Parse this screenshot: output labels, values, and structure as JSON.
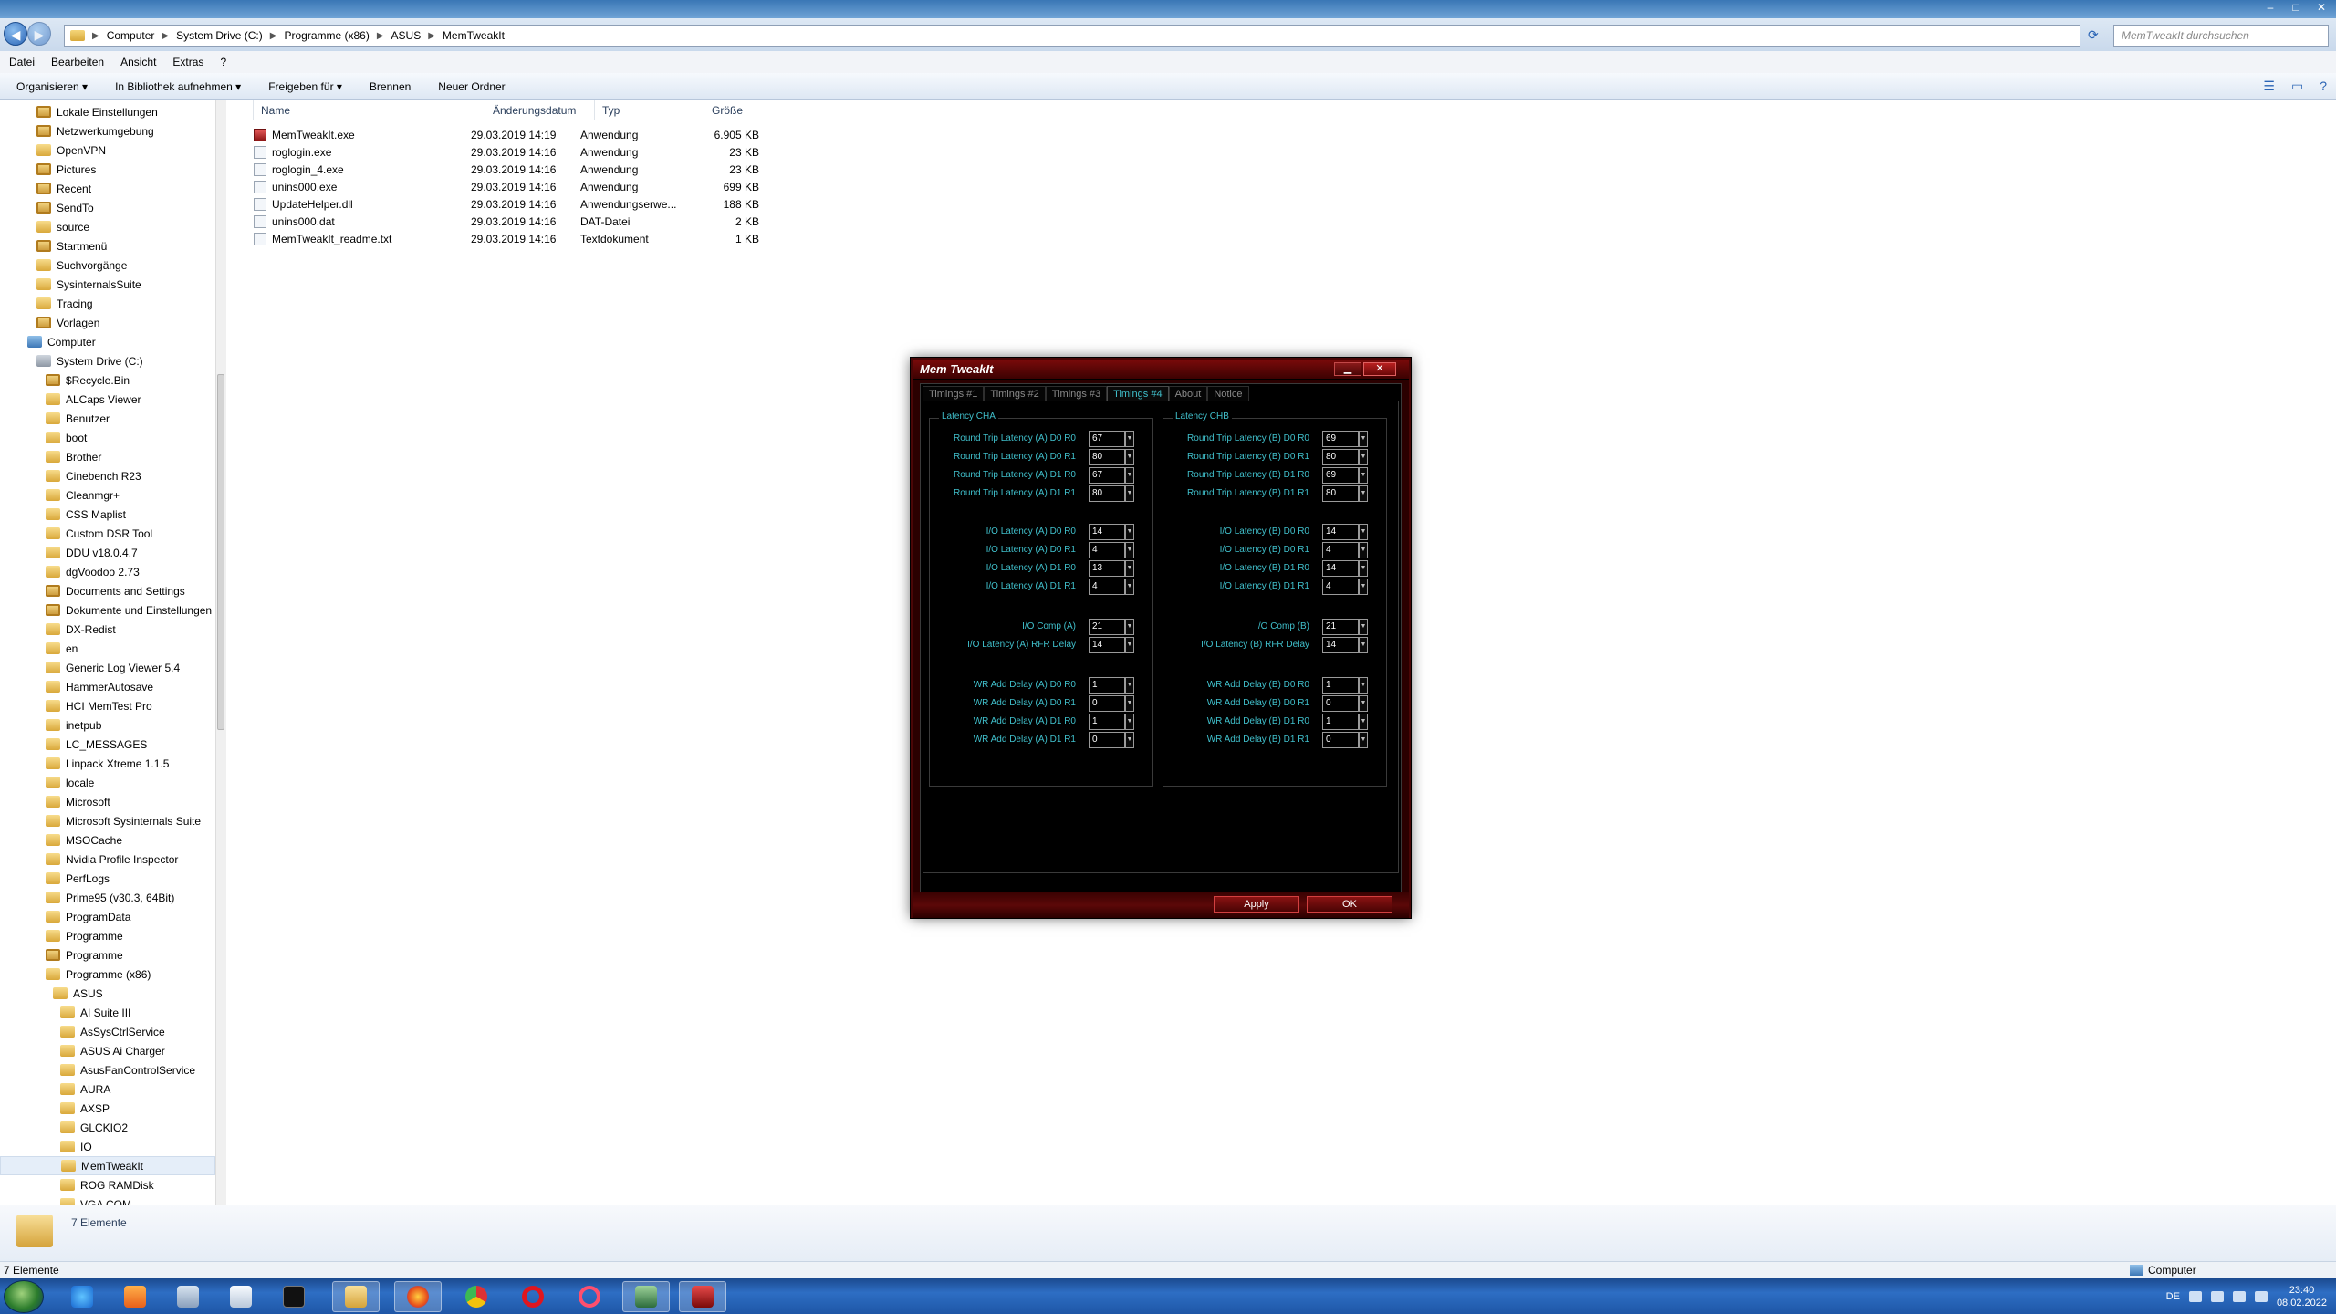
{
  "window": {
    "controls": [
      "–",
      "□",
      "✕"
    ]
  },
  "address": {
    "crumbs": [
      "Computer",
      "System Drive (C:)",
      "Programme (x86)",
      "ASUS",
      "MemTweakIt"
    ],
    "search_placeholder": "MemTweakIt durchsuchen"
  },
  "menubar": [
    "Datei",
    "Bearbeiten",
    "Ansicht",
    "Extras",
    "?"
  ],
  "toolbar": [
    "Organisieren ▾",
    "In Bibliothek aufnehmen ▾",
    "Freigeben für ▾",
    "Brennen",
    "Neuer Ordner"
  ],
  "nav": [
    {
      "label": "Lokale Einstellungen",
      "indent": 1,
      "icon": "special"
    },
    {
      "label": "Netzwerkumgebung",
      "indent": 1,
      "icon": "special"
    },
    {
      "label": "OpenVPN",
      "indent": 1,
      "icon": "folder"
    },
    {
      "label": "Pictures",
      "indent": 1,
      "icon": "special"
    },
    {
      "label": "Recent",
      "indent": 1,
      "icon": "special"
    },
    {
      "label": "SendTo",
      "indent": 1,
      "icon": "special"
    },
    {
      "label": "source",
      "indent": 1,
      "icon": "folder"
    },
    {
      "label": "Startmenü",
      "indent": 1,
      "icon": "special"
    },
    {
      "label": "Suchvorgänge",
      "indent": 1,
      "icon": "folder"
    },
    {
      "label": "SysinternalsSuite",
      "indent": 1,
      "icon": "folder"
    },
    {
      "label": "Tracing",
      "indent": 1,
      "icon": "folder"
    },
    {
      "label": "Vorlagen",
      "indent": 1,
      "icon": "special"
    },
    {
      "label": "Computer",
      "indent": 0,
      "icon": "pc"
    },
    {
      "label": "System Drive (C:)",
      "indent": 1,
      "icon": "drive"
    },
    {
      "label": "$Recycle.Bin",
      "indent": 2,
      "icon": "special"
    },
    {
      "label": "ALCaps Viewer",
      "indent": 2,
      "icon": "folder"
    },
    {
      "label": "Benutzer",
      "indent": 2,
      "icon": "folder"
    },
    {
      "label": "boot",
      "indent": 2,
      "icon": "folder"
    },
    {
      "label": "Brother",
      "indent": 2,
      "icon": "folder"
    },
    {
      "label": "Cinebench R23",
      "indent": 2,
      "icon": "folder"
    },
    {
      "label": "Cleanmgr+",
      "indent": 2,
      "icon": "folder"
    },
    {
      "label": "CSS Maplist",
      "indent": 2,
      "icon": "folder"
    },
    {
      "label": "Custom DSR Tool",
      "indent": 2,
      "icon": "folder"
    },
    {
      "label": "DDU v18.0.4.7",
      "indent": 2,
      "icon": "folder"
    },
    {
      "label": "dgVoodoo 2.73",
      "indent": 2,
      "icon": "folder"
    },
    {
      "label": "Documents and Settings",
      "indent": 2,
      "icon": "special"
    },
    {
      "label": "Dokumente und Einstellungen",
      "indent": 2,
      "icon": "special"
    },
    {
      "label": "DX-Redist",
      "indent": 2,
      "icon": "folder"
    },
    {
      "label": "en",
      "indent": 2,
      "icon": "folder"
    },
    {
      "label": "Generic Log Viewer 5.4",
      "indent": 2,
      "icon": "folder"
    },
    {
      "label": "HammerAutosave",
      "indent": 2,
      "icon": "folder"
    },
    {
      "label": "HCI MemTest Pro",
      "indent": 2,
      "icon": "folder"
    },
    {
      "label": "inetpub",
      "indent": 2,
      "icon": "folder"
    },
    {
      "label": "LC_MESSAGES",
      "indent": 2,
      "icon": "folder"
    },
    {
      "label": "Linpack Xtreme 1.1.5",
      "indent": 2,
      "icon": "folder"
    },
    {
      "label": "locale",
      "indent": 2,
      "icon": "folder"
    },
    {
      "label": "Microsoft",
      "indent": 2,
      "icon": "folder"
    },
    {
      "label": "Microsoft Sysinternals Suite",
      "indent": 2,
      "icon": "folder"
    },
    {
      "label": "MSOCache",
      "indent": 2,
      "icon": "folder"
    },
    {
      "label": "Nvidia Profile Inspector",
      "indent": 2,
      "icon": "folder"
    },
    {
      "label": "PerfLogs",
      "indent": 2,
      "icon": "folder"
    },
    {
      "label": "Prime95 (v30.3, 64Bit)",
      "indent": 2,
      "icon": "folder"
    },
    {
      "label": "ProgramData",
      "indent": 2,
      "icon": "folder"
    },
    {
      "label": "Programme",
      "indent": 2,
      "icon": "folder"
    },
    {
      "label": "Programme",
      "indent": 2,
      "icon": "special"
    },
    {
      "label": "Programme (x86)",
      "indent": 2,
      "icon": "folder"
    },
    {
      "label": "ASUS",
      "indent": 3,
      "icon": "folder"
    },
    {
      "label": "AI Suite III",
      "indent": 4,
      "icon": "folder"
    },
    {
      "label": "AsSysCtrlService",
      "indent": 4,
      "icon": "folder"
    },
    {
      "label": "ASUS Ai Charger",
      "indent": 4,
      "icon": "folder"
    },
    {
      "label": "AsusFanControlService",
      "indent": 4,
      "icon": "folder"
    },
    {
      "label": "AURA",
      "indent": 4,
      "icon": "folder"
    },
    {
      "label": "AXSP",
      "indent": 4,
      "icon": "folder"
    },
    {
      "label": "GLCKIO2",
      "indent": 4,
      "icon": "folder"
    },
    {
      "label": "IO",
      "indent": 4,
      "icon": "folder"
    },
    {
      "label": "MemTweakIt",
      "indent": 4,
      "icon": "folder",
      "selected": true
    },
    {
      "label": "ROG RAMDisk",
      "indent": 4,
      "icon": "folder"
    },
    {
      "label": "VGA COM",
      "indent": 4,
      "icon": "folder"
    }
  ],
  "columns": [
    "Name",
    "Änderungsdatum",
    "Typ",
    "Größe"
  ],
  "files": [
    {
      "name": "MemTweakIt.exe",
      "date": "29.03.2019 14:19",
      "type": "Anwendung",
      "size": "6.905 KB",
      "icon": "exe"
    },
    {
      "name": "roglogin.exe",
      "date": "29.03.2019 14:16",
      "type": "Anwendung",
      "size": "23 KB",
      "icon": "file"
    },
    {
      "name": "roglogin_4.exe",
      "date": "29.03.2019 14:16",
      "type": "Anwendung",
      "size": "23 KB",
      "icon": "file"
    },
    {
      "name": "unins000.exe",
      "date": "29.03.2019 14:16",
      "type": "Anwendung",
      "size": "699 KB",
      "icon": "file"
    },
    {
      "name": "UpdateHelper.dll",
      "date": "29.03.2019 14:16",
      "type": "Anwendungserwe...",
      "size": "188 KB",
      "icon": "file"
    },
    {
      "name": "unins000.dat",
      "date": "29.03.2019 14:16",
      "type": "DAT-Datei",
      "size": "2 KB",
      "icon": "file"
    },
    {
      "name": "MemTweakIt_readme.txt",
      "date": "29.03.2019 14:16",
      "type": "Textdokument",
      "size": "1 KB",
      "icon": "file"
    }
  ],
  "details": {
    "count": "7 Elemente"
  },
  "status": {
    "left": "7 Elemente",
    "right": "Computer"
  },
  "tray": {
    "lang": "DE",
    "time": "23:40",
    "date": "08.02.2022"
  },
  "memtweakit": {
    "title": "Mem TweakIt",
    "min": "▁",
    "close": "✕",
    "tabs": [
      "Timings #1",
      "Timings #2",
      "Timings #3",
      "Timings #4",
      "About",
      "Notice"
    ],
    "active_tab": 3,
    "groups": [
      {
        "title": "Latency CHA",
        "rows": [
          {
            "label": "Round Trip Latency (A) D0 R0",
            "value": "67"
          },
          {
            "label": "Round Trip Latency (A) D0 R1",
            "value": "80"
          },
          {
            "label": "Round Trip Latency (A) D1 R0",
            "value": "67"
          },
          {
            "label": "Round Trip Latency (A) D1 R1",
            "value": "80"
          },
          {
            "label": "I/O Latency (A) D0 R0",
            "value": "14"
          },
          {
            "label": "I/O Latency (A) D0 R1",
            "value": "4"
          },
          {
            "label": "I/O Latency (A) D1 R0",
            "value": "13"
          },
          {
            "label": "I/O Latency (A) D1 R1",
            "value": "4"
          },
          {
            "label": "I/O Comp (A)",
            "value": "21"
          },
          {
            "label": "I/O Latency (A) RFR Delay",
            "value": "14"
          },
          {
            "label": "WR Add Delay (A) D0 R0",
            "value": "1"
          },
          {
            "label": "WR Add Delay (A) D0 R1",
            "value": "0"
          },
          {
            "label": "WR Add Delay (A) D1 R0",
            "value": "1"
          },
          {
            "label": "WR Add Delay (A) D1 R1",
            "value": "0"
          }
        ]
      },
      {
        "title": "Latency CHB",
        "rows": [
          {
            "label": "Round Trip Latency (B) D0 R0",
            "value": "69"
          },
          {
            "label": "Round Trip Latency (B) D0 R1",
            "value": "80"
          },
          {
            "label": "Round Trip Latency (B) D1 R0",
            "value": "69"
          },
          {
            "label": "Round Trip Latency (B) D1 R1",
            "value": "80"
          },
          {
            "label": "I/O Latency (B) D0 R0",
            "value": "14"
          },
          {
            "label": "I/O Latency (B) D0 R1",
            "value": "4"
          },
          {
            "label": "I/O Latency (B) D1 R0",
            "value": "14"
          },
          {
            "label": "I/O Latency (B) D1 R1",
            "value": "4"
          },
          {
            "label": "I/O Comp (B)",
            "value": "21"
          },
          {
            "label": "I/O Latency (B) RFR Delay",
            "value": "14"
          },
          {
            "label": "WR Add Delay (B) D0 R0",
            "value": "1"
          },
          {
            "label": "WR Add Delay (B) D0 R1",
            "value": "0"
          },
          {
            "label": "WR Add Delay (B) D1 R0",
            "value": "1"
          },
          {
            "label": "WR Add Delay (B) D1 R1",
            "value": "0"
          }
        ]
      }
    ],
    "apply": "Apply",
    "ok": "OK"
  },
  "colors": {
    "accent_cyan": "#40c0cc",
    "mt_red": "#7a0a0a",
    "taskbar": "#2e6ec4"
  }
}
